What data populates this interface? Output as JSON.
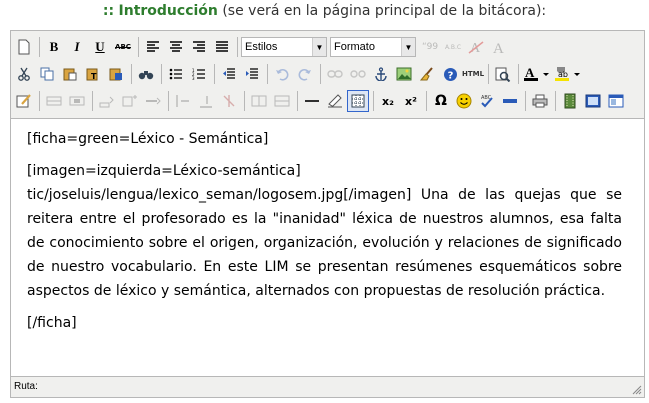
{
  "heading": {
    "separator": "::",
    "name": "Introducción",
    "note": "(se verá en la página principal de la bitácora):"
  },
  "toolbar": {
    "bold_label": "B",
    "italic_label": "I",
    "underline_label": "U",
    "strike_label": "ABC",
    "styles_select": "Estilos",
    "format_select": "Formato",
    "quote_label": "“99",
    "abbr_label": "A.B.C",
    "forecolor_label": "A",
    "html_label": "HTML",
    "sub_label": "x₂",
    "sup_label": "x²",
    "omega_label": "Ω"
  },
  "content": {
    "paragraphs": [
      "[ficha=green=Léxico - Semántica]",
      "[imagen=izquierda=Léxico-semántica] tic/joseluis/lengua/lexico_seman/logosem.jpg[/imagen] Una de las quejas que se reitera entre el profesorado es la \"inanidad\" léxica de nuestros alumnos, esa falta de conocimiento sobre el origen, organización, evolución y relaciones de significado de nuestro vocabulario. En este LIM se presentan resúmenes esquemáticos sobre aspectos de léxico y semántica, alternados con propuestas de resolución práctica.",
      "[/ficha]"
    ]
  },
  "statusbar": {
    "path_label": "Ruta:"
  }
}
